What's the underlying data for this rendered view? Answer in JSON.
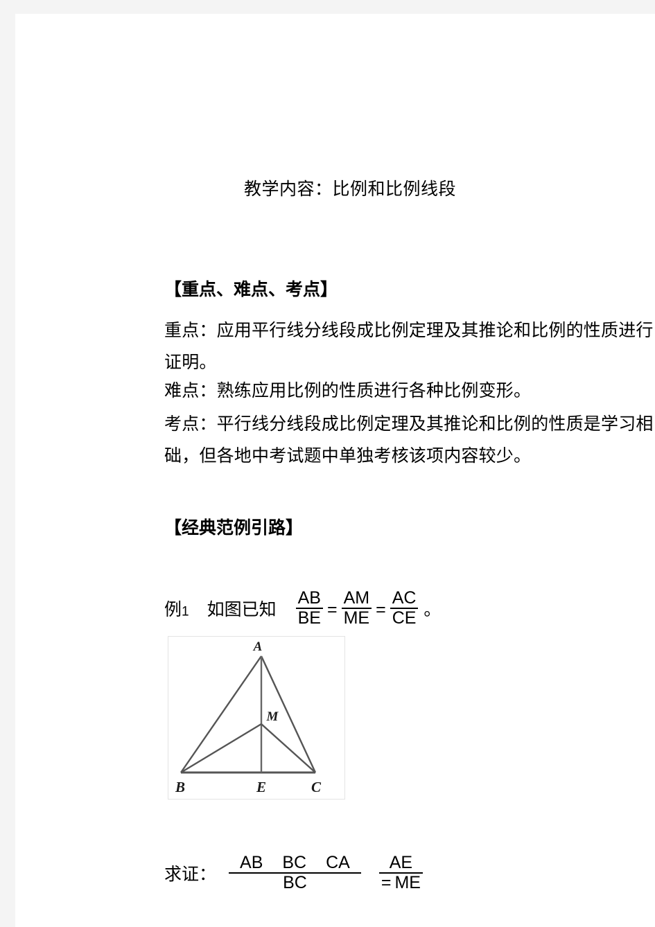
{
  "document": {
    "title": "教学内容：比例和比例线段",
    "sections": {
      "key_points_heading": "【重点、难点、考点】",
      "key_points": {
        "zhongdian_line1": "重点：应用平行线分线段成比例定理及其推论和比例的性质进行",
        "zhongdian_line2": "证明。",
        "nandian_line": "难点：熟练应用比例的性质进行各种比例变形。",
        "kaodian_line1": "考点：平行线分线段成比例定理及其推论和比例的性质是学习相",
        "kaodian_line2": "础，但各地中考试题中单独考核该项内容较少。"
      },
      "examples_heading": "【经典范例引路】"
    },
    "example1": {
      "label": "例",
      "number": "1",
      "lead_text": "如图已知",
      "fractions": [
        {
          "numerator": "AB",
          "denominator": "BE"
        },
        {
          "numerator": "AM",
          "denominator": "ME"
        },
        {
          "numerator": "AC",
          "denominator": "CE"
        }
      ],
      "equals": "=",
      "trailing_punctuation": "。"
    },
    "figure": {
      "caption_vertices": {
        "apex": "A",
        "bottom_left": "B",
        "bottom_mid": "E",
        "bottom_right": "C",
        "interior": "M"
      },
      "border_color": "#e3e3e3",
      "line_color": "#555555"
    },
    "proof": {
      "label": "求证：",
      "left_fraction": {
        "numerator_terms": [
          "AB",
          "BC",
          "CA"
        ],
        "denominator": "BC"
      },
      "equals": "=",
      "right_fraction": {
        "numerator": "AE",
        "denominator": "ME"
      }
    }
  }
}
